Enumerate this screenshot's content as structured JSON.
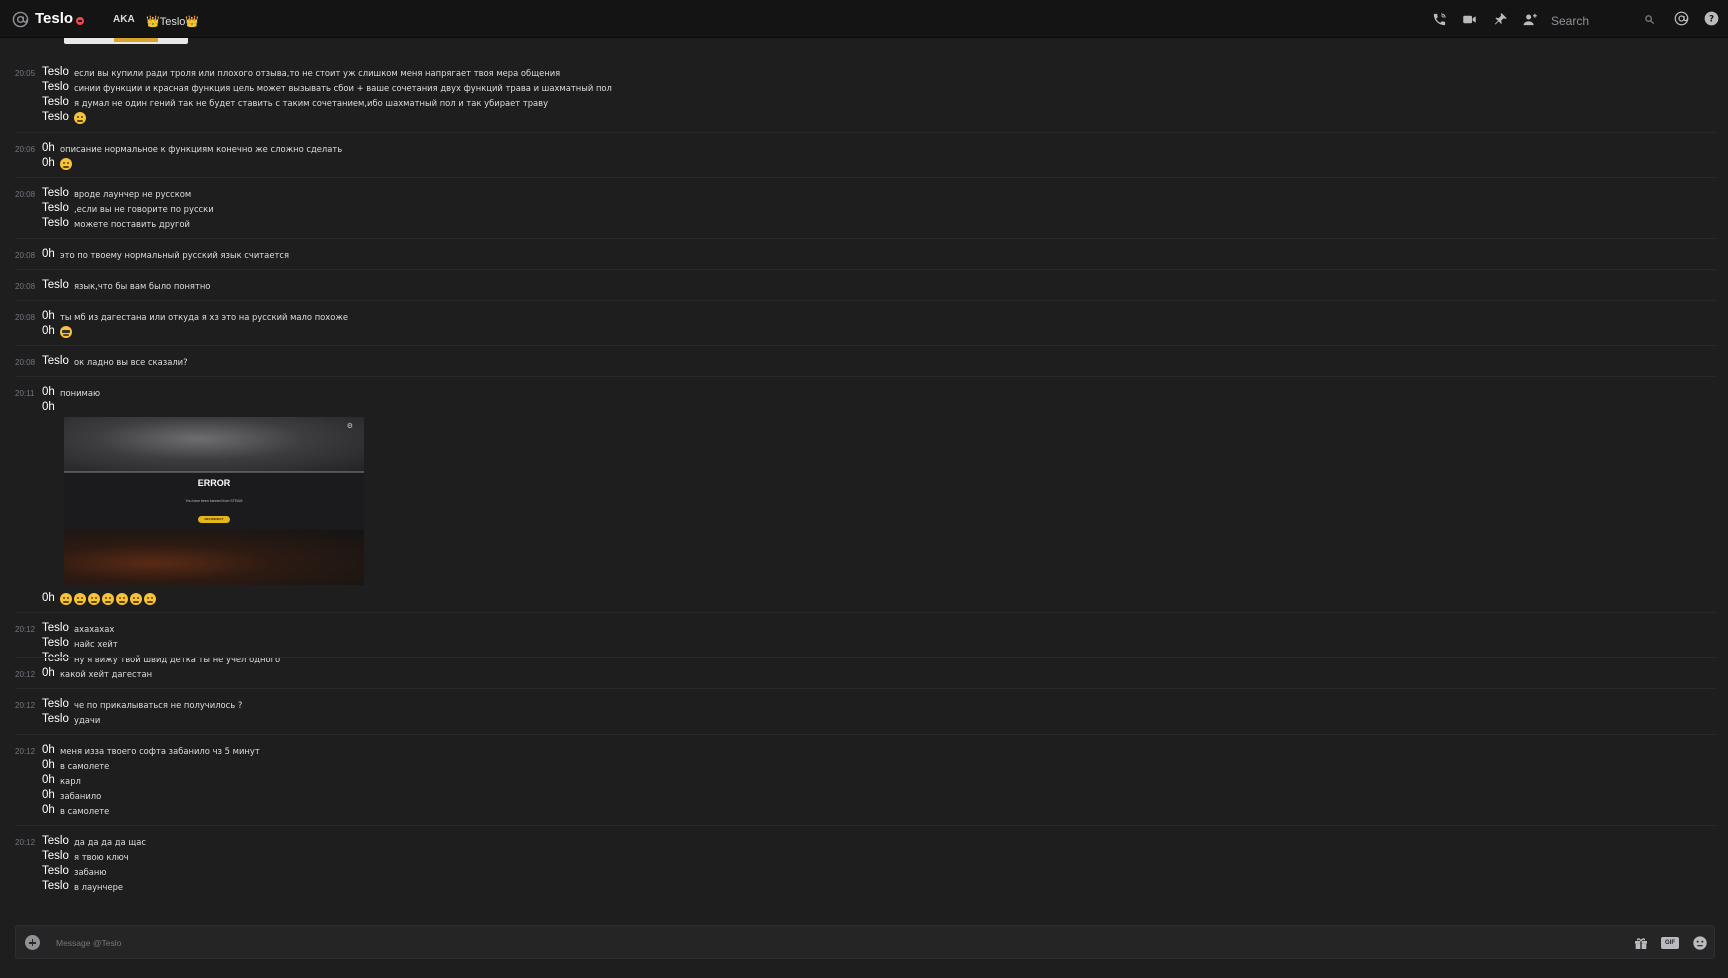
{
  "header": {
    "title": "Teslo",
    "aka_label": "AKA",
    "nickname": "👑Teslo👑",
    "search_placeholder": "Search",
    "icons": [
      "at-icon",
      "do-not-disturb-icon",
      "voice-call-icon",
      "video-call-icon",
      "pin-icon",
      "add-friend-icon",
      "search-icon",
      "mentions-icon",
      "help-icon"
    ]
  },
  "messages": [
    {
      "time": "20:05",
      "lines": [
        {
          "author": "Teslo",
          "text": "если вы купили ради троля или плохого отзыва,то не стоит уж слишком меня напрягает твоя мера общения"
        },
        {
          "author": "Teslo",
          "text": "синии функции и красная функция цель может вызывать сбои + ваше сочетания двух функций трава и шахматный пол"
        },
        {
          "author": "Teslo",
          "text": "я думал не один гений так не будет ставить с таким сочетанием,ибо шахматный пол и так убирает траву"
        },
        {
          "author": "Teslo",
          "text": "",
          "emoji": [
            "confused-face"
          ]
        }
      ]
    },
    {
      "time": "20:06",
      "lines": [
        {
          "author": "0h",
          "text": "описание нормальное к функциям конечно же сложно сделать"
        },
        {
          "author": "0h",
          "text": "",
          "emoji": [
            "thinking-face"
          ]
        }
      ]
    },
    {
      "time": "20:08",
      "lines": [
        {
          "author": "Teslo",
          "text": "вроде лаунчер не русском"
        },
        {
          "author": "Teslo",
          "text": ",если вы не говорите по русски"
        },
        {
          "author": "Teslo",
          "text": "можете поставить другой"
        }
      ]
    },
    {
      "time": "20:08",
      "lines": [
        {
          "author": "0h",
          "text": "это по твоему нормальный русский язык считается"
        }
      ]
    },
    {
      "time": "20:08",
      "lines": [
        {
          "author": "Teslo",
          "text": "язык,что бы вам было понятно"
        }
      ]
    },
    {
      "time": "20:08",
      "lines": [
        {
          "author": "0h",
          "text": "ты мб из дагестана или откуда я хз это на русский мало похоже"
        },
        {
          "author": "0h",
          "text": "",
          "emoji": [
            "sunglasses-face"
          ]
        }
      ]
    },
    {
      "time": "20:08",
      "lines": [
        {
          "author": "Teslo",
          "text": "ок ладно вы все сказали?"
        }
      ]
    },
    {
      "time": "20:11",
      "lines": [
        {
          "author": "0h",
          "text": "понимаю"
        },
        {
          "author": "0h",
          "text": ""
        },
        {
          "author": "0h",
          "text": "",
          "emoji": [
            "thinking-face",
            "thinking-face",
            "thinking-face",
            "thinking-face",
            "thinking-face",
            "thinking-face",
            "thinking-face"
          ]
        }
      ],
      "attachment": {
        "title": "ERROR",
        "subtitle": "You have been banned from STEAM",
        "button": "RECONNECT",
        "gear": "⚙"
      }
    },
    {
      "time": "20:12",
      "lines": [
        {
          "author": "Teslo",
          "text": "ахахахах"
        },
        {
          "author": "Teslo",
          "text": "найс хейт"
        },
        {
          "author": "Teslo",
          "text": "ну я вижу твой швид детка ты не учел одного"
        }
      ]
    },
    {
      "time": "20:12",
      "lines": [
        {
          "author": "0h",
          "text": "какой хейт дагестан"
        }
      ]
    },
    {
      "time": "20:12",
      "lines": [
        {
          "author": "Teslo",
          "text": "че по прикалываться не получилось ?"
        },
        {
          "author": "Teslo",
          "text": "удачи"
        }
      ]
    },
    {
      "time": "20:12",
      "lines": [
        {
          "author": "0h",
          "text": "меня изза твоего софта забанило чз 5 минут"
        },
        {
          "author": "0h",
          "text": "в самолете"
        },
        {
          "author": "0h",
          "text": "карл"
        },
        {
          "author": "0h",
          "text": "забанило"
        },
        {
          "author": "0h",
          "text": "в самолете"
        }
      ]
    },
    {
      "time": "20:12",
      "lines": [
        {
          "author": "Teslo",
          "text": "да да да да щас"
        },
        {
          "author": "Teslo",
          "text": "я твою ключ"
        },
        {
          "author": "Teslo",
          "text": "забаню"
        },
        {
          "author": "Teslo",
          "text": "в лаунчере"
        }
      ]
    }
  ],
  "composer": {
    "placeholder": "Message @Teslo",
    "gif_label": "GIF",
    "icons": [
      "upload-plus-icon",
      "gift-icon",
      "gif-icon",
      "emoji-picker-icon"
    ]
  },
  "colors": {
    "background": "#1e1e1f",
    "header": "#141415",
    "dnd": "#f04747",
    "accent_yellow": "#e5b51c"
  }
}
